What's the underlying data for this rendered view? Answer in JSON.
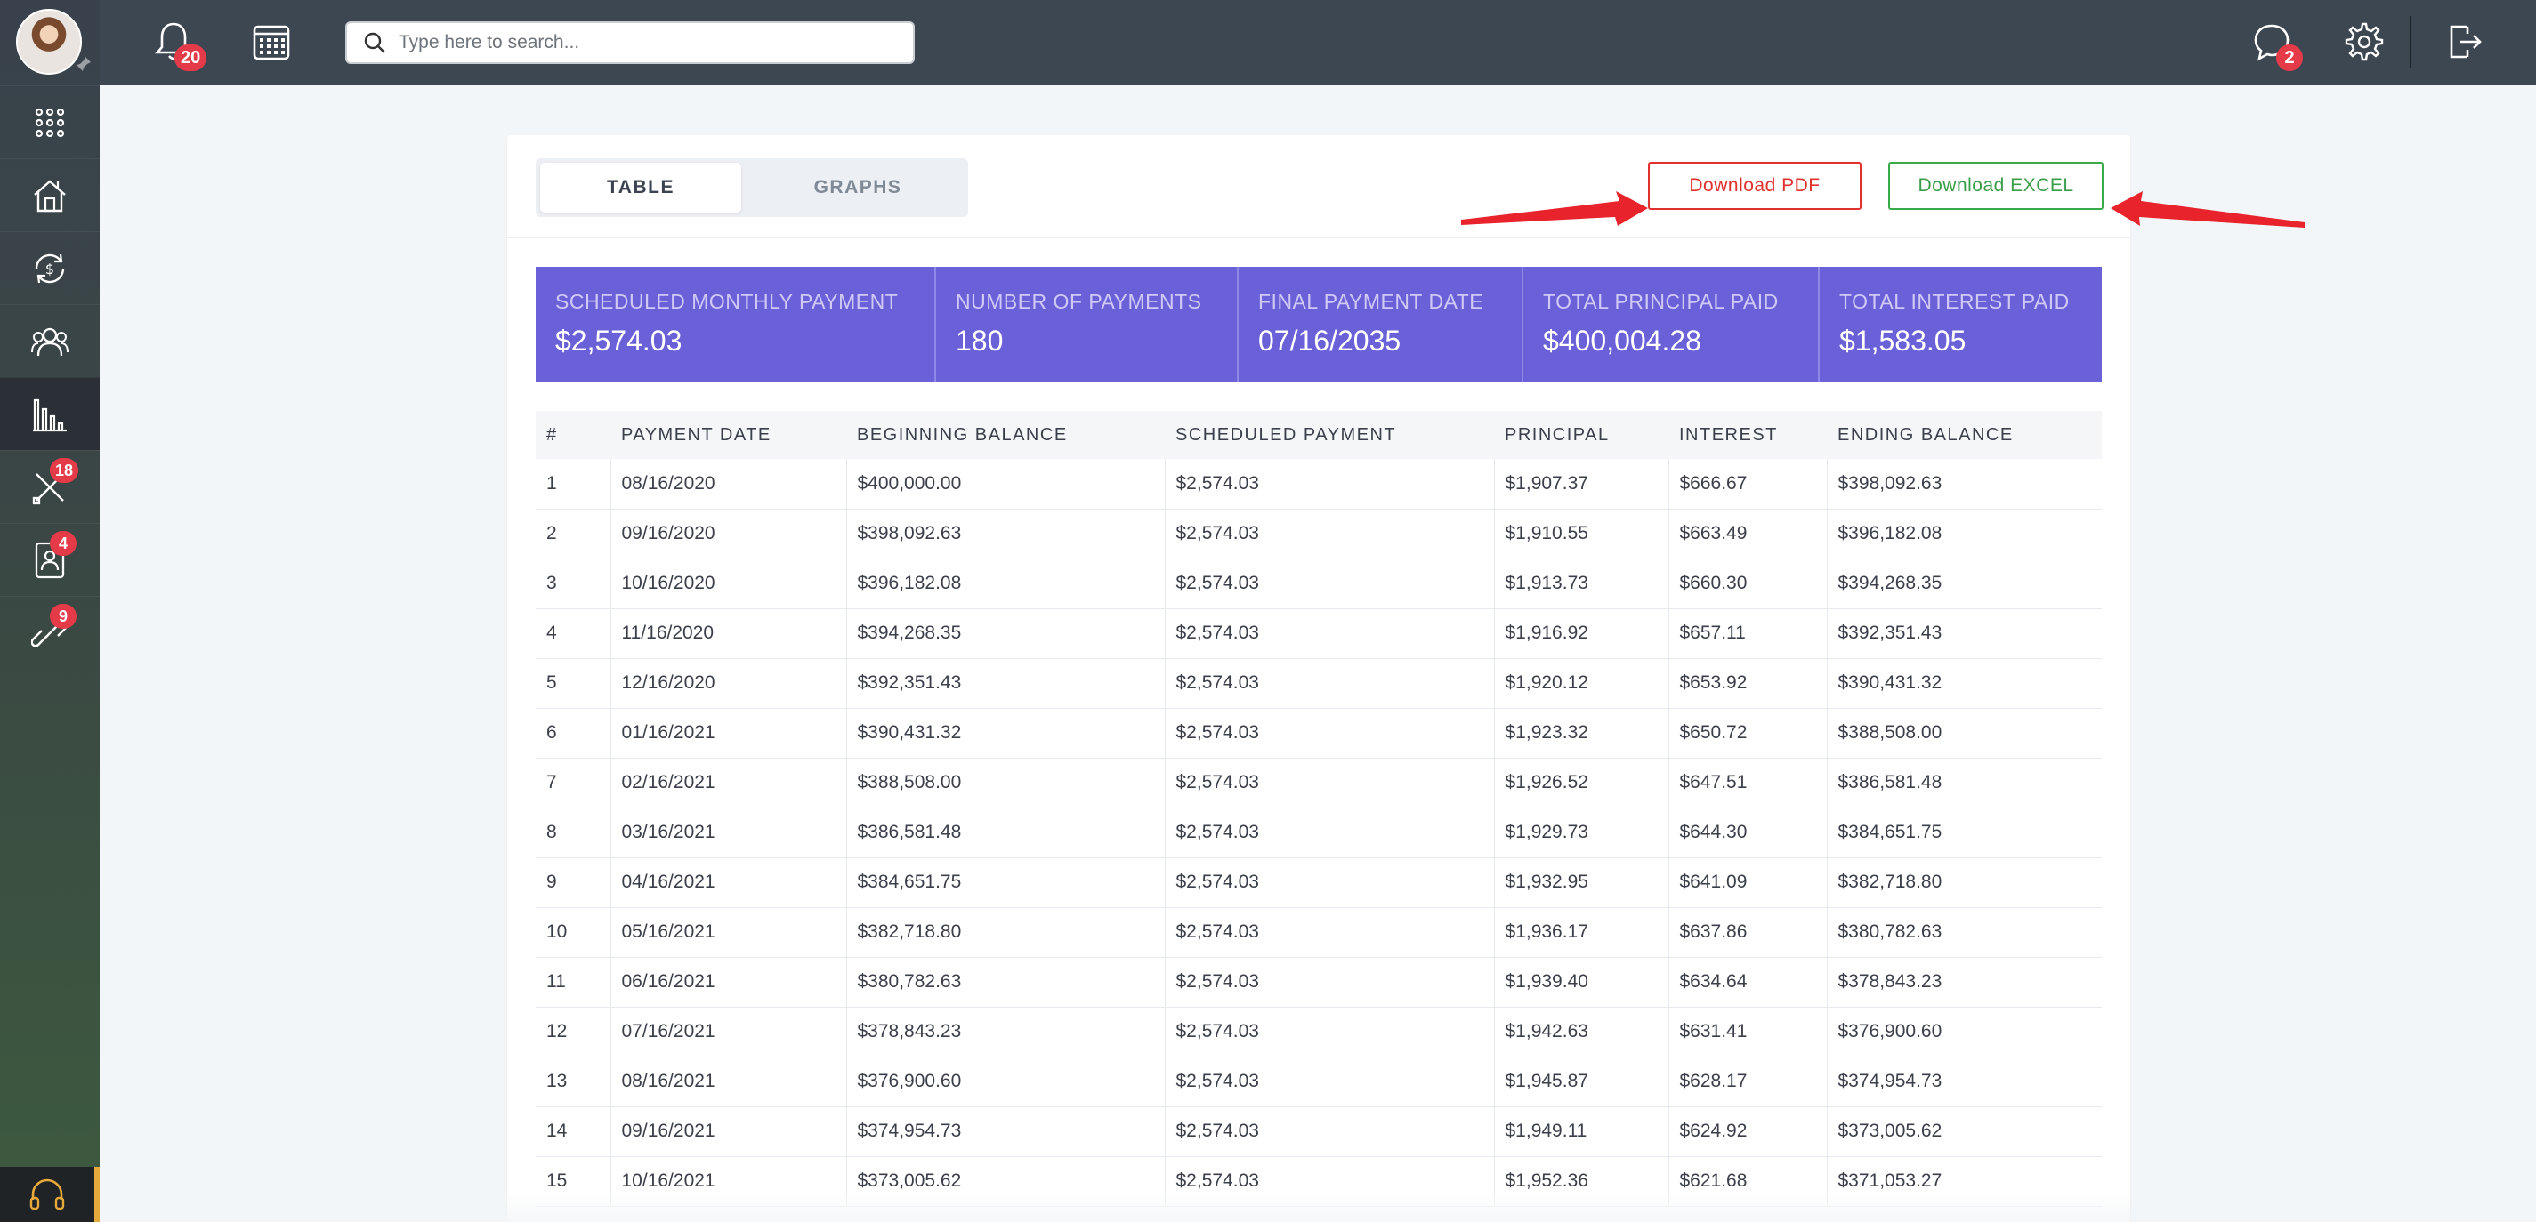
{
  "topbar": {
    "notification_count": "20",
    "search_placeholder": "Type here to search...",
    "chat_count": "2"
  },
  "sidebar": {
    "items": [
      {
        "icon": "apps-grid-icon"
      },
      {
        "icon": "house-icon"
      },
      {
        "icon": "refinance-icon"
      },
      {
        "icon": "users-icon"
      },
      {
        "icon": "bar-chart-icon",
        "active": true
      },
      {
        "icon": "tools-icon",
        "badge": "18"
      },
      {
        "icon": "contact-card-icon",
        "badge": "4"
      },
      {
        "icon": "link-icon",
        "badge": "9"
      }
    ]
  },
  "tabs": {
    "table": "TABLE",
    "graphs": "GRAPHS",
    "active": "table"
  },
  "actions": {
    "pdf": "Download PDF",
    "excel": "Download EXCEL"
  },
  "colors": {
    "summary_bg": "#6a61d9",
    "pdf": "#e0312f",
    "excel": "#3aa94a",
    "arrow": "#e8232b"
  },
  "summary": [
    {
      "label": "SCHEDULED MONTHLY PAYMENT",
      "value": "$2,574.03"
    },
    {
      "label": "NUMBER OF PAYMENTS",
      "value": "180"
    },
    {
      "label": "FINAL PAYMENT DATE",
      "value": "07/16/2035"
    },
    {
      "label": "TOTAL PRINCIPAL PAID",
      "value": "$400,004.28"
    },
    {
      "label": "TOTAL INTEREST PAID",
      "value": "$1,583.05"
    }
  ],
  "table": {
    "columns": [
      "#",
      "PAYMENT DATE",
      "BEGINNING BALANCE",
      "SCHEDULED PAYMENT",
      "PRINCIPAL",
      "INTEREST",
      "ENDING BALANCE"
    ],
    "rows": [
      [
        "1",
        "08/16/2020",
        "$400,000.00",
        "$2,574.03",
        "$1,907.37",
        "$666.67",
        "$398,092.63"
      ],
      [
        "2",
        "09/16/2020",
        "$398,092.63",
        "$2,574.03",
        "$1,910.55",
        "$663.49",
        "$396,182.08"
      ],
      [
        "3",
        "10/16/2020",
        "$396,182.08",
        "$2,574.03",
        "$1,913.73",
        "$660.30",
        "$394,268.35"
      ],
      [
        "4",
        "11/16/2020",
        "$394,268.35",
        "$2,574.03",
        "$1,916.92",
        "$657.11",
        "$392,351.43"
      ],
      [
        "5",
        "12/16/2020",
        "$392,351.43",
        "$2,574.03",
        "$1,920.12",
        "$653.92",
        "$390,431.32"
      ],
      [
        "6",
        "01/16/2021",
        "$390,431.32",
        "$2,574.03",
        "$1,923.32",
        "$650.72",
        "$388,508.00"
      ],
      [
        "7",
        "02/16/2021",
        "$388,508.00",
        "$2,574.03",
        "$1,926.52",
        "$647.51",
        "$386,581.48"
      ],
      [
        "8",
        "03/16/2021",
        "$386,581.48",
        "$2,574.03",
        "$1,929.73",
        "$644.30",
        "$384,651.75"
      ],
      [
        "9",
        "04/16/2021",
        "$384,651.75",
        "$2,574.03",
        "$1,932.95",
        "$641.09",
        "$382,718.80"
      ],
      [
        "10",
        "05/16/2021",
        "$382,718.80",
        "$2,574.03",
        "$1,936.17",
        "$637.86",
        "$380,782.63"
      ],
      [
        "11",
        "06/16/2021",
        "$380,782.63",
        "$2,574.03",
        "$1,939.40",
        "$634.64",
        "$378,843.23"
      ],
      [
        "12",
        "07/16/2021",
        "$378,843.23",
        "$2,574.03",
        "$1,942.63",
        "$631.41",
        "$376,900.60"
      ],
      [
        "13",
        "08/16/2021",
        "$376,900.60",
        "$2,574.03",
        "$1,945.87",
        "$628.17",
        "$374,954.73"
      ],
      [
        "14",
        "09/16/2021",
        "$374,954.73",
        "$2,574.03",
        "$1,949.11",
        "$624.92",
        "$373,005.62"
      ],
      [
        "15",
        "10/16/2021",
        "$373,005.62",
        "$2,574.03",
        "$1,952.36",
        "$621.68",
        "$371,053.27"
      ]
    ]
  }
}
